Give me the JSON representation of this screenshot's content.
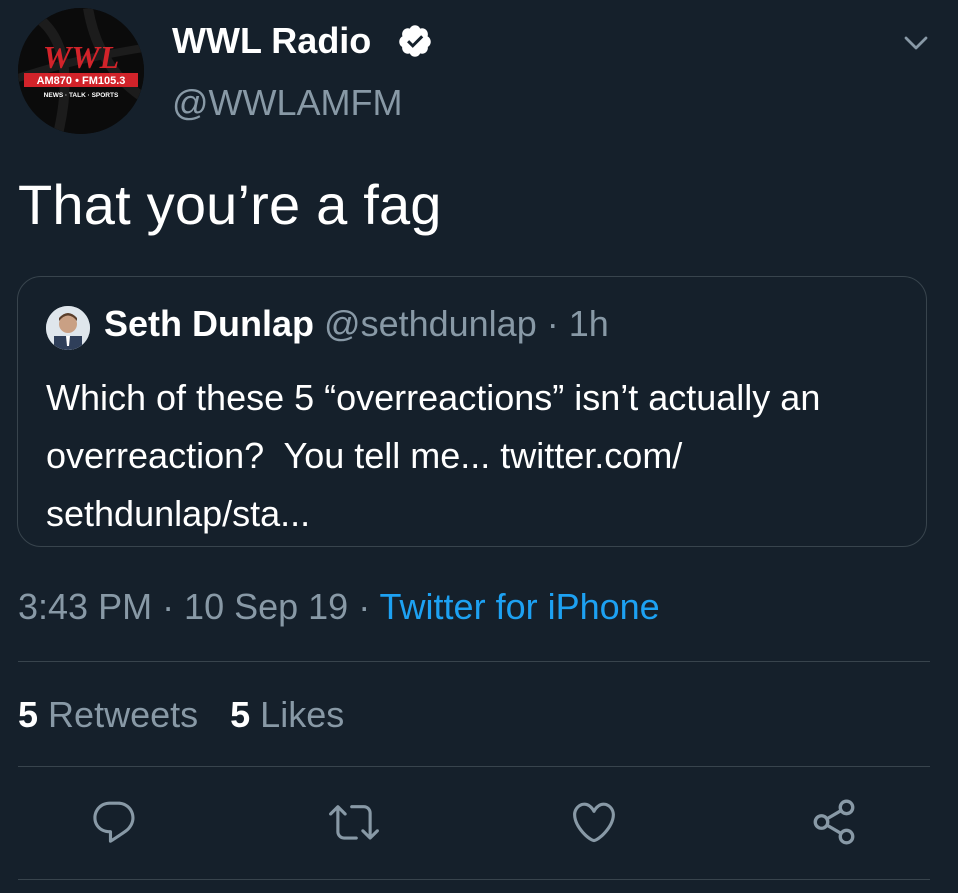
{
  "author": {
    "display_name": "WWL Radio",
    "handle": "@WWLAMFM",
    "avatar": {
      "logo_text": "WWL",
      "frequencies": "AM870 • FM105.3",
      "tagline": "NEWS · TALK · SPORTS"
    },
    "verified": true
  },
  "tweet": {
    "text": "That you’re a fag"
  },
  "quoted_tweet": {
    "name": "Seth Dunlap",
    "meta": "@sethdunlap · 1h",
    "text": "Which of these 5 “overreactions” isn’t actually an overreaction?  You tell me... twitter.com/ sethdunlap/sta..."
  },
  "metadata": {
    "time_date": "3:43 PM · 10 Sep 19 · ",
    "source": "Twitter for iPhone"
  },
  "stats": {
    "retweets_count": "5",
    "retweets_label": "Retweets",
    "likes_count": "5",
    "likes_label": "Likes"
  },
  "icons": {
    "verified": "verified-badge-icon",
    "menu": "chevron-down-icon",
    "reply": "reply-icon",
    "retweet": "retweet-icon",
    "like": "heart-icon",
    "share": "share-icon"
  },
  "colors": {
    "background": "#15202b",
    "secondary_text": "#8899a6",
    "link": "#1da1f2",
    "border": "#38444d",
    "logo_red": "#d2232a"
  }
}
